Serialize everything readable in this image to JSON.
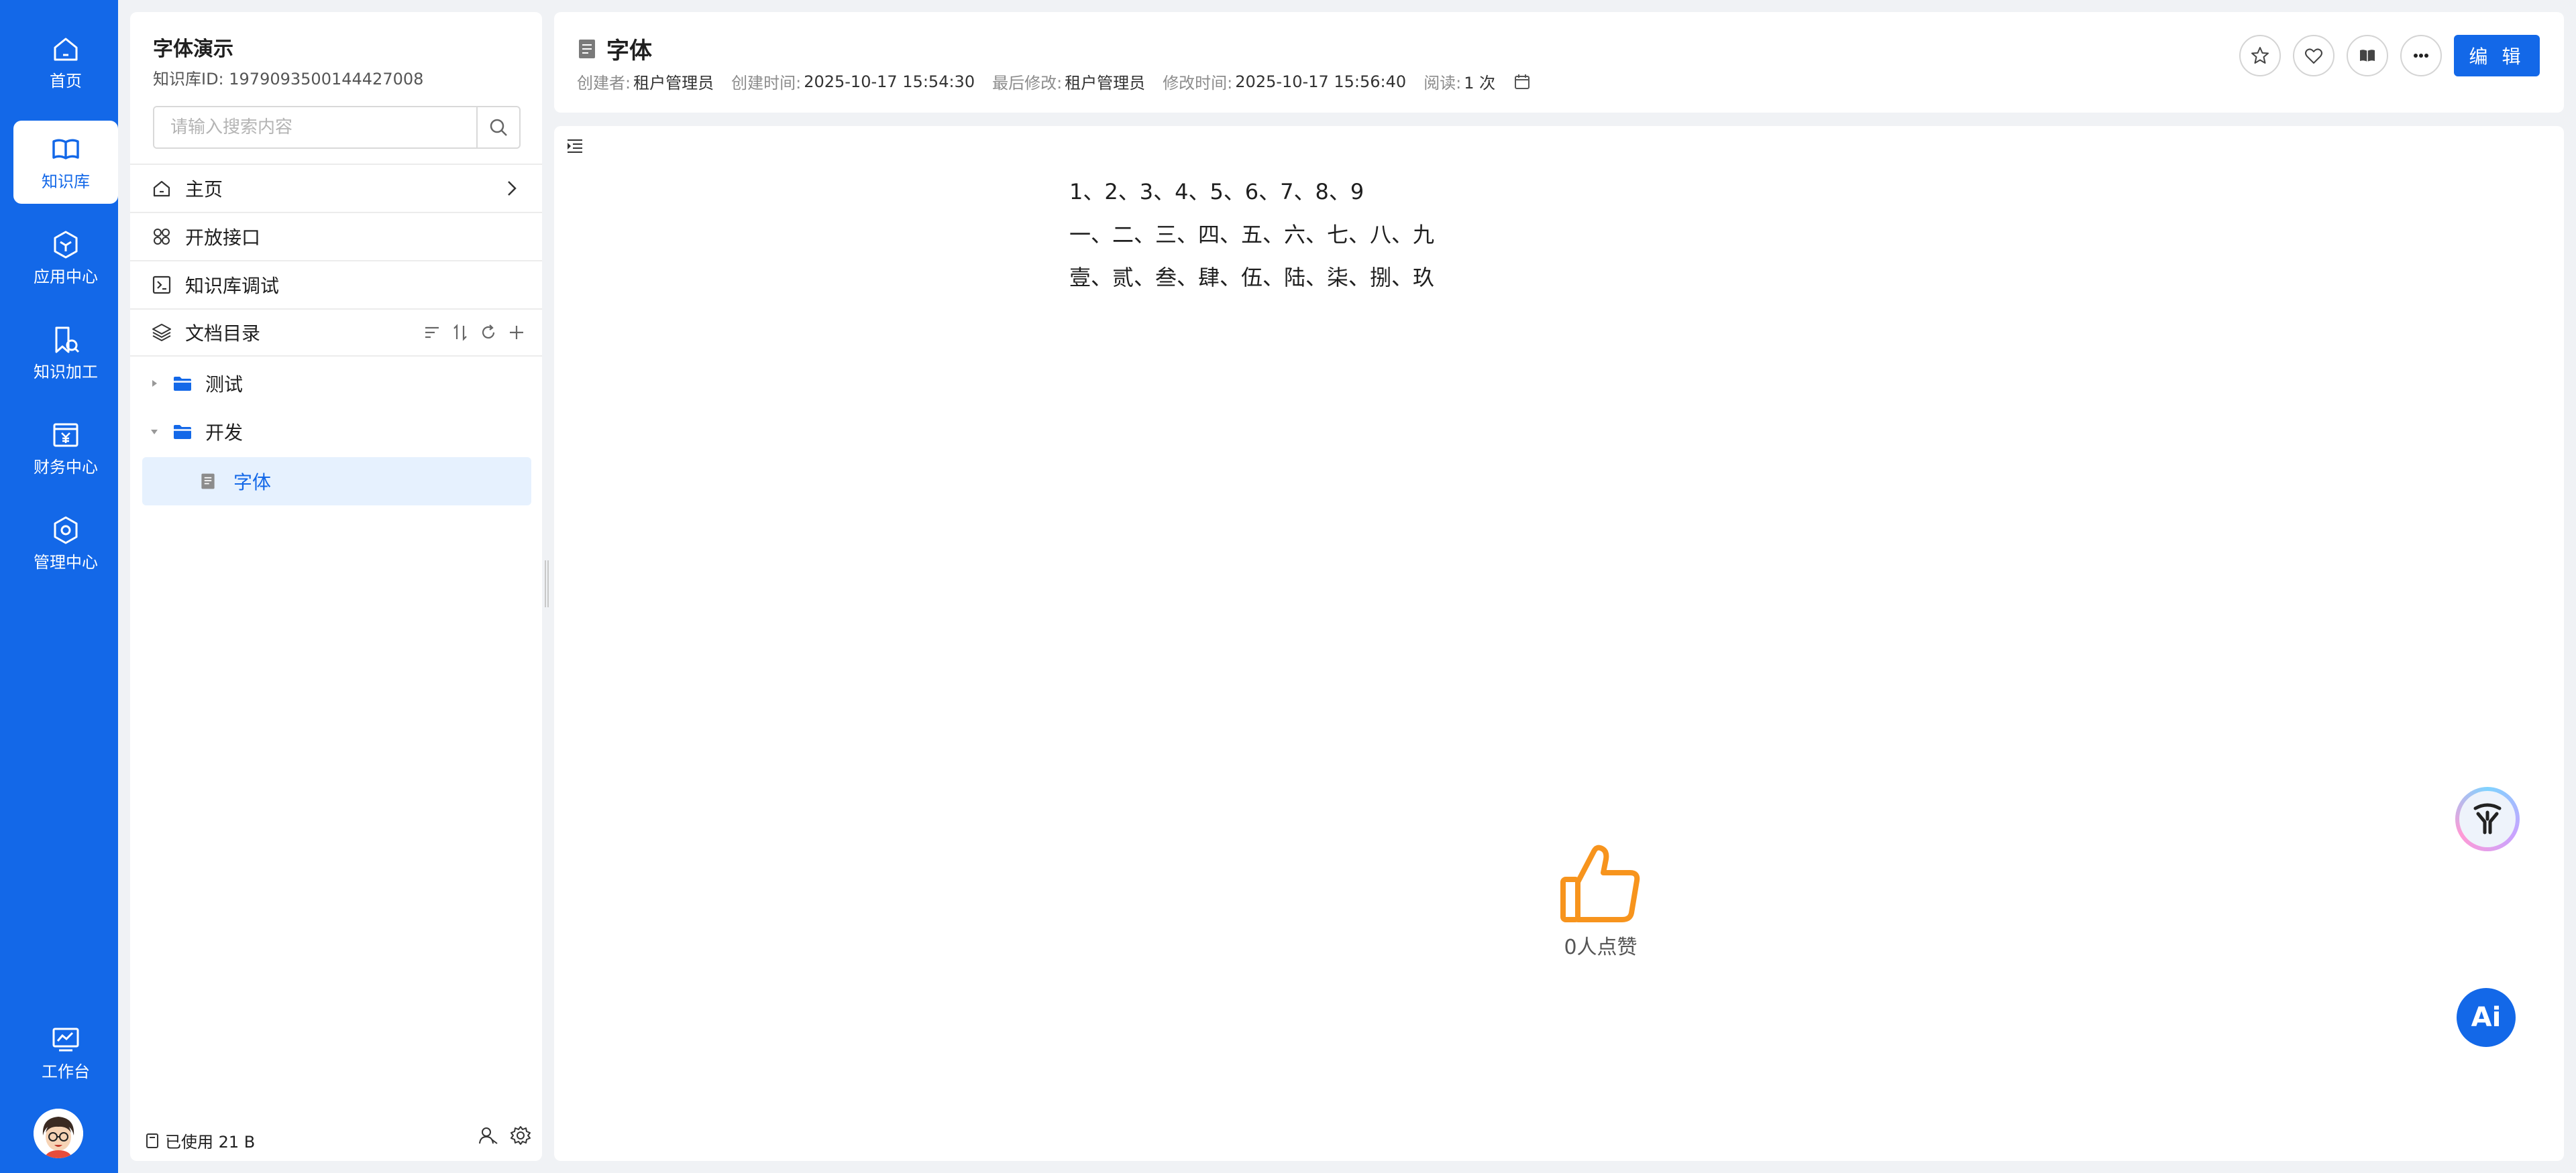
{
  "rail": {
    "items": [
      {
        "label": "首页",
        "icon": "home-icon"
      },
      {
        "label": "知识库",
        "icon": "book-icon"
      },
      {
        "label": "应用中心",
        "icon": "app-cube-icon"
      },
      {
        "label": "知识加工",
        "icon": "doc-process-icon"
      },
      {
        "label": "财务中心",
        "icon": "finance-icon"
      },
      {
        "label": "管理中心",
        "icon": "hex-gear-icon"
      }
    ],
    "workbench_label": "工作台",
    "active_index": 1
  },
  "sidebar": {
    "kb_title": "字体演示",
    "kb_id": "知识库ID: 1979093500144427008",
    "search_placeholder": "请输入搜索内容",
    "nav": {
      "home": "主页",
      "open_api": "开放接口",
      "debug": "知识库调试",
      "doc_dir": "文档目录"
    },
    "tree": {
      "folder1": "测试",
      "folder2": "开发",
      "doc1": "字体"
    },
    "usage": "已使用 21 B"
  },
  "header": {
    "title": "字体",
    "meta": {
      "creator_k": "创建者:",
      "creator_v": "租户管理员",
      "created_k": "创建时间:",
      "created_v": "2025-10-17 15:54:30",
      "modifier_k": "最后修改:",
      "modifier_v": "租户管理员",
      "modified_k": "修改时间:",
      "modified_v": "2025-10-17 15:56:40",
      "reads_k": "阅读:",
      "reads_v": "1 次"
    },
    "edit_label": "编 辑"
  },
  "content": {
    "lines": [
      "1、2、3、4、5、6、7、8、9",
      "一、二、三、四、五、六、七、八、九",
      "壹、贰、叁、肆、伍、陆、柒、捌、玖"
    ],
    "like_count": "0人点赞"
  },
  "floating": {
    "ai_label": "Ai"
  },
  "colors": {
    "brand": "#1368e8",
    "like": "#f7941d",
    "selected_bg": "#e6f1fe"
  }
}
